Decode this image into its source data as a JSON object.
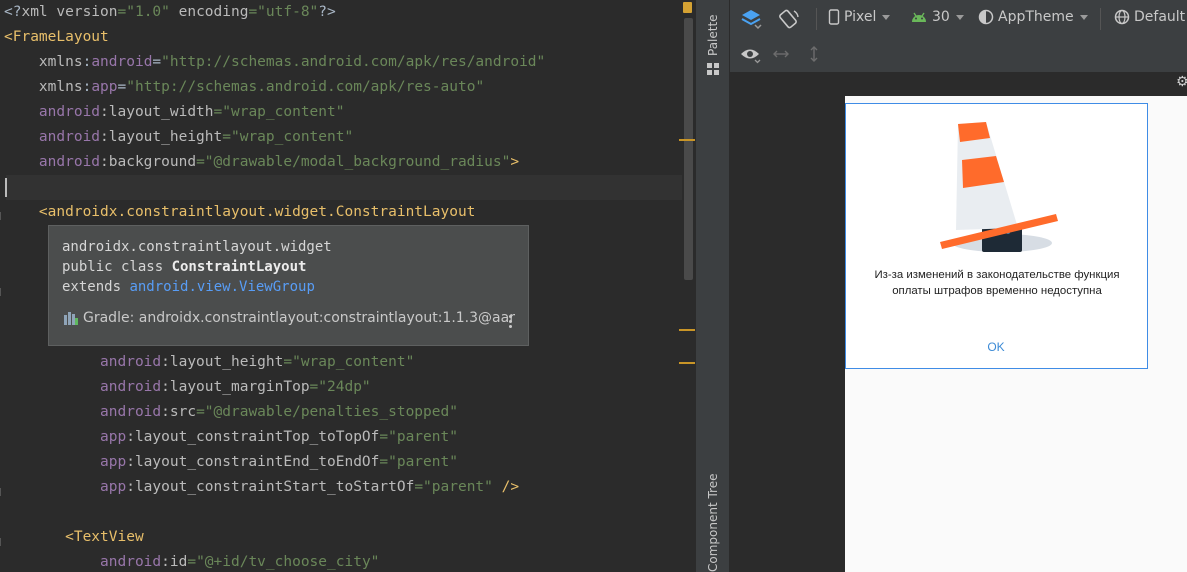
{
  "editor": {
    "lines": [
      {
        "parts": [
          {
            "t": "<?",
            "c": "plain"
          },
          {
            "t": "xml version",
            "c": "attr"
          },
          {
            "t": "=\"1.0\" ",
            "c": "val"
          },
          {
            "t": "encoding",
            "c": "attr"
          },
          {
            "t": "=\"utf-8\"",
            "c": "val"
          },
          {
            "t": "?>",
            "c": "plain"
          }
        ]
      },
      {
        "parts": [
          {
            "t": "<",
            "c": "tag"
          },
          {
            "t": "FrameLayout",
            "c": "tag"
          }
        ]
      },
      {
        "parts": [
          {
            "t": "    xmlns",
            "c": "attr"
          },
          {
            "t": ":",
            "c": "plain"
          },
          {
            "t": "android",
            "c": "pfx"
          },
          {
            "t": "=",
            "c": "plain"
          },
          {
            "t": "\"http://schemas.android.com/apk/res/android\"",
            "c": "val"
          }
        ]
      },
      {
        "parts": [
          {
            "t": "    xmlns",
            "c": "attr"
          },
          {
            "t": ":",
            "c": "plain"
          },
          {
            "t": "app",
            "c": "pfx"
          },
          {
            "t": "=",
            "c": "plain"
          },
          {
            "t": "\"http://schemas.android.com/apk/res-auto\"",
            "c": "val"
          }
        ]
      },
      {
        "parts": [
          {
            "t": "    android",
            "c": "pfx"
          },
          {
            "t": ":layout_width",
            "c": "attr"
          },
          {
            "t": "=\"wrap_content\"",
            "c": "val"
          }
        ]
      },
      {
        "parts": [
          {
            "t": "    android",
            "c": "pfx"
          },
          {
            "t": ":layout_height",
            "c": "attr"
          },
          {
            "t": "=\"wrap_content\"",
            "c": "val"
          }
        ]
      },
      {
        "parts": [
          {
            "t": "    android",
            "c": "pfx"
          },
          {
            "t": ":background",
            "c": "attr"
          },
          {
            "t": "=\"@drawable/modal_background_radius\"",
            "c": "val"
          },
          {
            "t": ">",
            "c": "tag"
          }
        ]
      },
      {
        "parts": []
      },
      {
        "parts": [
          {
            "t": "    <androidx.constraintlayout.widget.ConstraintLayout",
            "c": "tag"
          }
        ]
      },
      {
        "parts": []
      },
      {
        "parts": []
      },
      {
        "parts": []
      },
      {
        "parts": []
      },
      {
        "parts": []
      },
      {
        "parts": [
          {
            "t": "           android",
            "c": "pfx"
          },
          {
            "t": ":layout_height",
            "c": "attr"
          },
          {
            "t": "=\"wrap_content\"",
            "c": "val"
          }
        ]
      },
      {
        "parts": [
          {
            "t": "           android",
            "c": "pfx"
          },
          {
            "t": ":layout_marginTop",
            "c": "attr"
          },
          {
            "t": "=\"24dp\"",
            "c": "val"
          }
        ]
      },
      {
        "parts": [
          {
            "t": "           android",
            "c": "pfx"
          },
          {
            "t": ":src",
            "c": "attr"
          },
          {
            "t": "=\"@drawable/penalties_stopped\"",
            "c": "val"
          }
        ]
      },
      {
        "parts": [
          {
            "t": "           app",
            "c": "pfx"
          },
          {
            "t": ":layout_constraintTop_toTopOf",
            "c": "attr"
          },
          {
            "t": "=\"parent\"",
            "c": "val"
          }
        ]
      },
      {
        "parts": [
          {
            "t": "           app",
            "c": "pfx"
          },
          {
            "t": ":layout_constraintEnd_toEndOf",
            "c": "attr"
          },
          {
            "t": "=\"parent\"",
            "c": "val"
          }
        ]
      },
      {
        "parts": [
          {
            "t": "           app",
            "c": "pfx"
          },
          {
            "t": ":layout_constraintStart_toStartOf",
            "c": "attr"
          },
          {
            "t": "=\"parent\" ",
            "c": "val"
          },
          {
            "t": "/>",
            "c": "tag"
          }
        ]
      },
      {
        "parts": []
      },
      {
        "parts": [
          {
            "t": "       <TextView",
            "c": "tag"
          }
        ]
      },
      {
        "parts": [
          {
            "t": "           android",
            "c": "pfx"
          },
          {
            "t": ":id",
            "c": "attr"
          },
          {
            "t": "=\"@+id/tv_choose_city\"",
            "c": "val"
          }
        ]
      }
    ]
  },
  "tooltip": {
    "package": "androidx.constraintlayout.widget",
    "decl_prefix": "public class ",
    "class_name": "ConstraintLayout",
    "extends_prefix": "extends ",
    "extends_link": "android.view.ViewGroup",
    "gradle": "Gradle: androidx.constraintlayout:constraintlayout:1.1.3@aar"
  },
  "side_panels": {
    "palette": "Palette",
    "component_tree": "Component Tree"
  },
  "toolbar": {
    "device": "Pixel",
    "api": "30",
    "theme": "AppTheme",
    "locale": "Default"
  },
  "dialog": {
    "message": "Из-за изменений в законодательстве функция оплаты штрафов временно недоступна",
    "ok": "OK"
  },
  "colors": {
    "accent": "#3f8ce6",
    "cone": "#ff6b2b",
    "warning": "#c99527"
  }
}
